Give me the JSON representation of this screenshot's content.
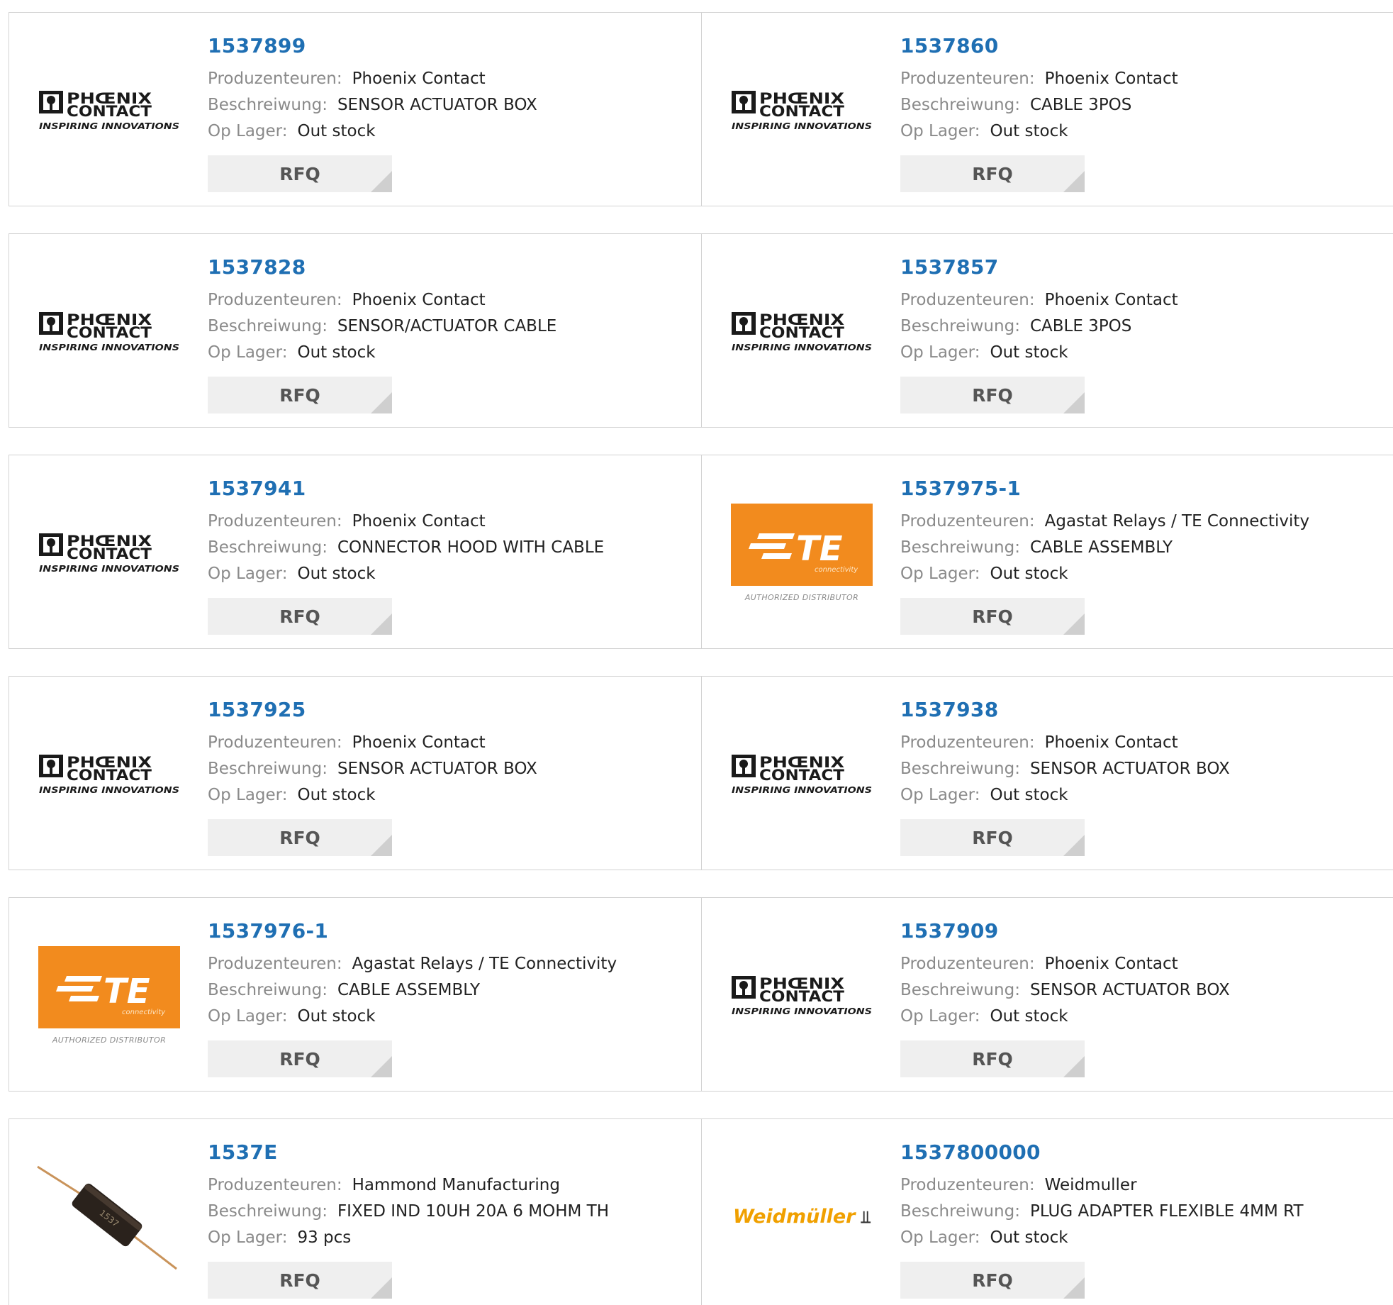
{
  "labels": {
    "manufacturer": "Produzenteuren:",
    "description": "Beschreiwung:",
    "stock": "Op Lager:",
    "rfq": "RFQ"
  },
  "logo_text": {
    "phoenix_line1": "PHŒNIX",
    "phoenix_line2": "CONTACT",
    "phoenix_tagline": "INSPIRING INNOVATIONS",
    "te_main": "TE",
    "te_sub": "connectivity",
    "te_tagline": "AUTHORIZED DISTRIBUTOR",
    "weidmuller": "Weidmüller"
  },
  "colors": {
    "part_link": "#1f6fb3",
    "te_orange": "#f28b1e",
    "weidmuller_yellow": "#f0a000"
  },
  "products": [
    {
      "part": "1537899",
      "manufacturer": "Phoenix Contact",
      "description": "SENSOR ACTUATOR BOX",
      "stock": "Out stock",
      "logo": "phoenix-contact-logo"
    },
    {
      "part": "1537860",
      "manufacturer": "Phoenix Contact",
      "description": "CABLE 3POS",
      "stock": "Out stock",
      "logo": "phoenix-contact-logo"
    },
    {
      "part": "1537828",
      "manufacturer": "Phoenix Contact",
      "description": "SENSOR/ACTUATOR CABLE",
      "stock": "Out stock",
      "logo": "phoenix-contact-logo"
    },
    {
      "part": "1537857",
      "manufacturer": "Phoenix Contact",
      "description": "CABLE 3POS",
      "stock": "Out stock",
      "logo": "phoenix-contact-logo"
    },
    {
      "part": "1537941",
      "manufacturer": "Phoenix Contact",
      "description": "CONNECTOR HOOD WITH CABLE",
      "stock": "Out stock",
      "logo": "phoenix-contact-logo"
    },
    {
      "part": "1537975-1",
      "manufacturer": "Agastat Relays / TE Connectivity",
      "description": "CABLE ASSEMBLY",
      "stock": "Out stock",
      "logo": "te-connectivity-logo"
    },
    {
      "part": "1537925",
      "manufacturer": "Phoenix Contact",
      "description": "SENSOR ACTUATOR BOX",
      "stock": "Out stock",
      "logo": "phoenix-contact-logo"
    },
    {
      "part": "1537938",
      "manufacturer": "Phoenix Contact",
      "description": "SENSOR ACTUATOR BOX",
      "stock": "Out stock",
      "logo": "phoenix-contact-logo"
    },
    {
      "part": "1537976-1",
      "manufacturer": "Agastat Relays / TE Connectivity",
      "description": "CABLE ASSEMBLY",
      "stock": "Out stock",
      "logo": "te-connectivity-logo"
    },
    {
      "part": "1537909",
      "manufacturer": "Phoenix Contact",
      "description": "SENSOR ACTUATOR BOX",
      "stock": "Out stock",
      "logo": "phoenix-contact-logo"
    },
    {
      "part": "1537E",
      "manufacturer": "Hammond Manufacturing",
      "description": "FIXED IND 10UH 20A 6 MOHM TH",
      "stock": "93 pcs",
      "logo": "inductor-photo"
    },
    {
      "part": "1537800000",
      "manufacturer": "Weidmuller",
      "description": "PLUG ADAPTER FLEXIBLE 4MM RT",
      "stock": "Out stock",
      "logo": "weidmuller-logo"
    }
  ]
}
